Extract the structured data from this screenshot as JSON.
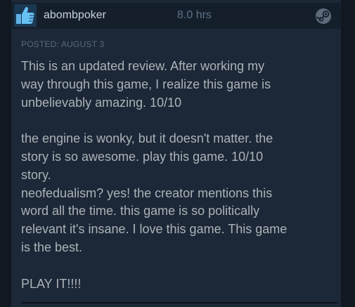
{
  "review": {
    "reviewer_name": "abombpoker",
    "hours": "8.0 hrs",
    "posted": "POSTED: AUGUST 3",
    "recommendation_icon": "thumbs-up-icon",
    "platform_icon": "steam-icon",
    "body": {
      "line_1": "This is an updated review. After working my",
      "line_2": "way through this game, I realize this game is",
      "line_3": "unbelievably amazing. 10/10",
      "line_4": "the engine is wonky, but it doesn't matter. the",
      "line_5": "story is so awesome. play this game. 10/10",
      "line_6": "story.",
      "line_7": "neofedualism? yes! the creator mentions this",
      "line_8": "word all the time. this game is so politically",
      "line_9": "relevant it's insane. I love this game. This game",
      "line_10": "is the best.",
      "line_11": "PLAY IT!!!!"
    }
  },
  "colors": {
    "page_background": "#111822",
    "card_background": "#1c2837",
    "header_background": "#151e2b",
    "name_color": "#c6d4df",
    "hours_color": "#5c7286",
    "body_text": "#acb2b8",
    "thumb_blue": "#67c1f5"
  }
}
